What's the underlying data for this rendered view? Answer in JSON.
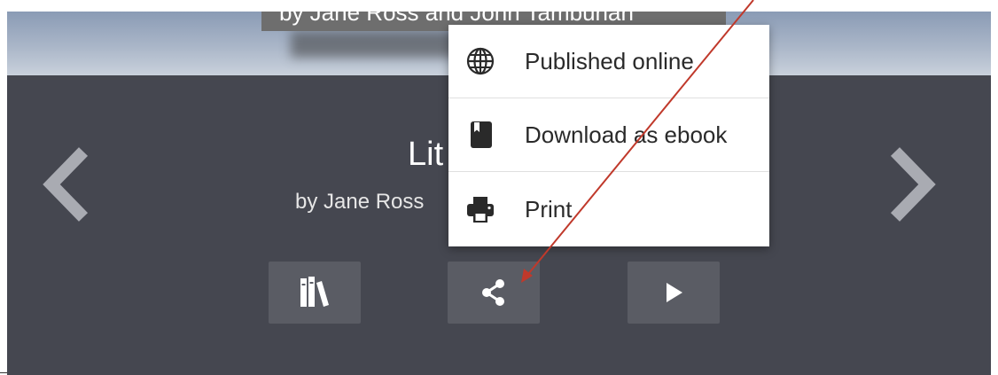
{
  "cover": {
    "caption": "by Jane Ross and John Tambunan"
  },
  "book": {
    "title": "Lit",
    "byline": "by Jane Ross"
  },
  "navigation": {
    "prev_icon": "chevron-left-icon",
    "next_icon": "chevron-right-icon"
  },
  "actions": [
    {
      "icon": "library-books-icon"
    },
    {
      "icon": "share-icon"
    },
    {
      "icon": "play-icon"
    }
  ],
  "share_menu": {
    "items": [
      {
        "label": "Published online",
        "icon": "globe-icon"
      },
      {
        "label": "Download as ebook",
        "icon": "book-icon"
      },
      {
        "label": "Print",
        "icon": "printer-icon"
      }
    ]
  },
  "colors": {
    "panel_background": "#454750",
    "button_background": "#5a5c64",
    "menu_background": "#ffffff",
    "annotation_arrow": "#c0392b"
  }
}
